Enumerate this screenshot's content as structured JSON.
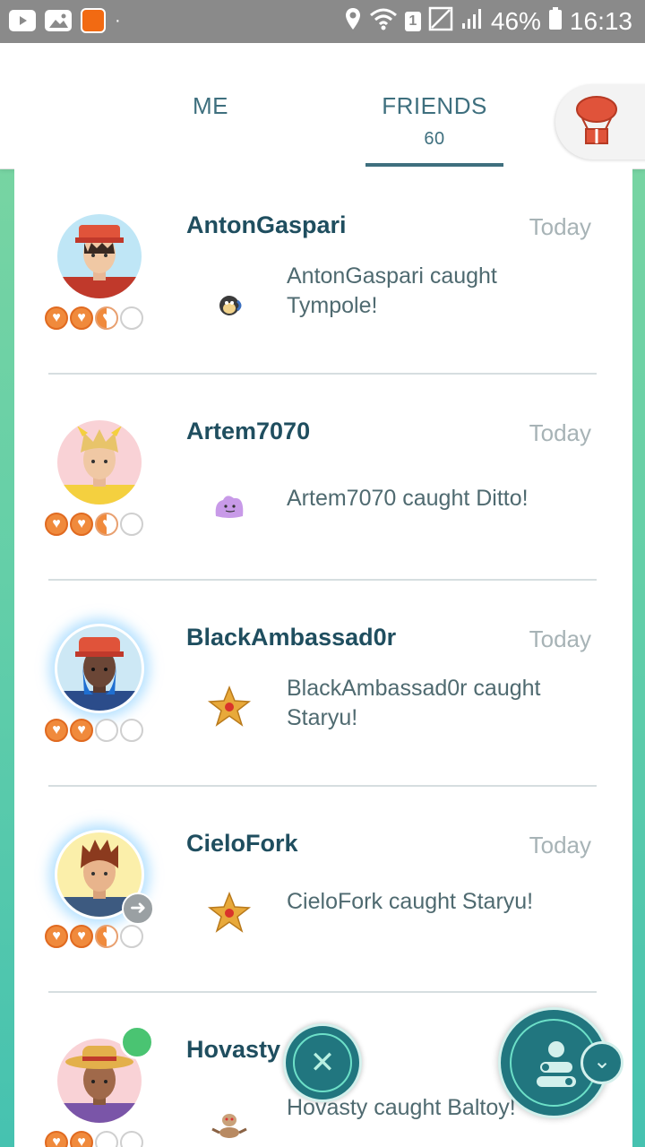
{
  "status_bar": {
    "badge": "1",
    "battery": "46%",
    "time": "16:13",
    "dot": "·"
  },
  "tabs": {
    "me": "ME",
    "friends": "FRIENDS",
    "friends_count": "60"
  },
  "friends": [
    {
      "name": "AntonGaspari",
      "date": "Today",
      "activity": "AntonGaspari caught Tympole!",
      "hearts": [
        "full",
        "full",
        "half",
        "empty"
      ],
      "pokemon_icon": "tympole-icon"
    },
    {
      "name": "Artem7070",
      "date": "Today",
      "activity": "Artem7070 caught Ditto!",
      "hearts": [
        "full",
        "full",
        "half",
        "empty"
      ],
      "pokemon_icon": "ditto-icon"
    },
    {
      "name": "BlackAmbassad0r",
      "date": "Today",
      "activity": "BlackAmbassad0r caught Staryu!",
      "hearts": [
        "full",
        "full",
        "empty",
        "empty"
      ],
      "pokemon_icon": "staryu-icon"
    },
    {
      "name": "CieloFork",
      "date": "Today",
      "activity": "CieloFork caught Staryu!",
      "hearts": [
        "full",
        "full",
        "half",
        "empty"
      ],
      "pokemon_icon": "staryu-icon"
    },
    {
      "name": "Hovasty",
      "date": "",
      "activity": "Hovasty caught Baltoy!",
      "hearts": [
        "full",
        "full",
        "empty",
        "empty"
      ],
      "pokemon_icon": "baltoy-icon"
    }
  ],
  "colors": {
    "accent": "#3e6f7e",
    "name_text": "#1f4e5f",
    "heart_fill": "#f08a3c",
    "button_teal": "#21767f",
    "team_red": "#e0533a",
    "team_yellow": "#f4d03f",
    "team_blue": "#1f6fd1",
    "online": "#4ac472"
  }
}
